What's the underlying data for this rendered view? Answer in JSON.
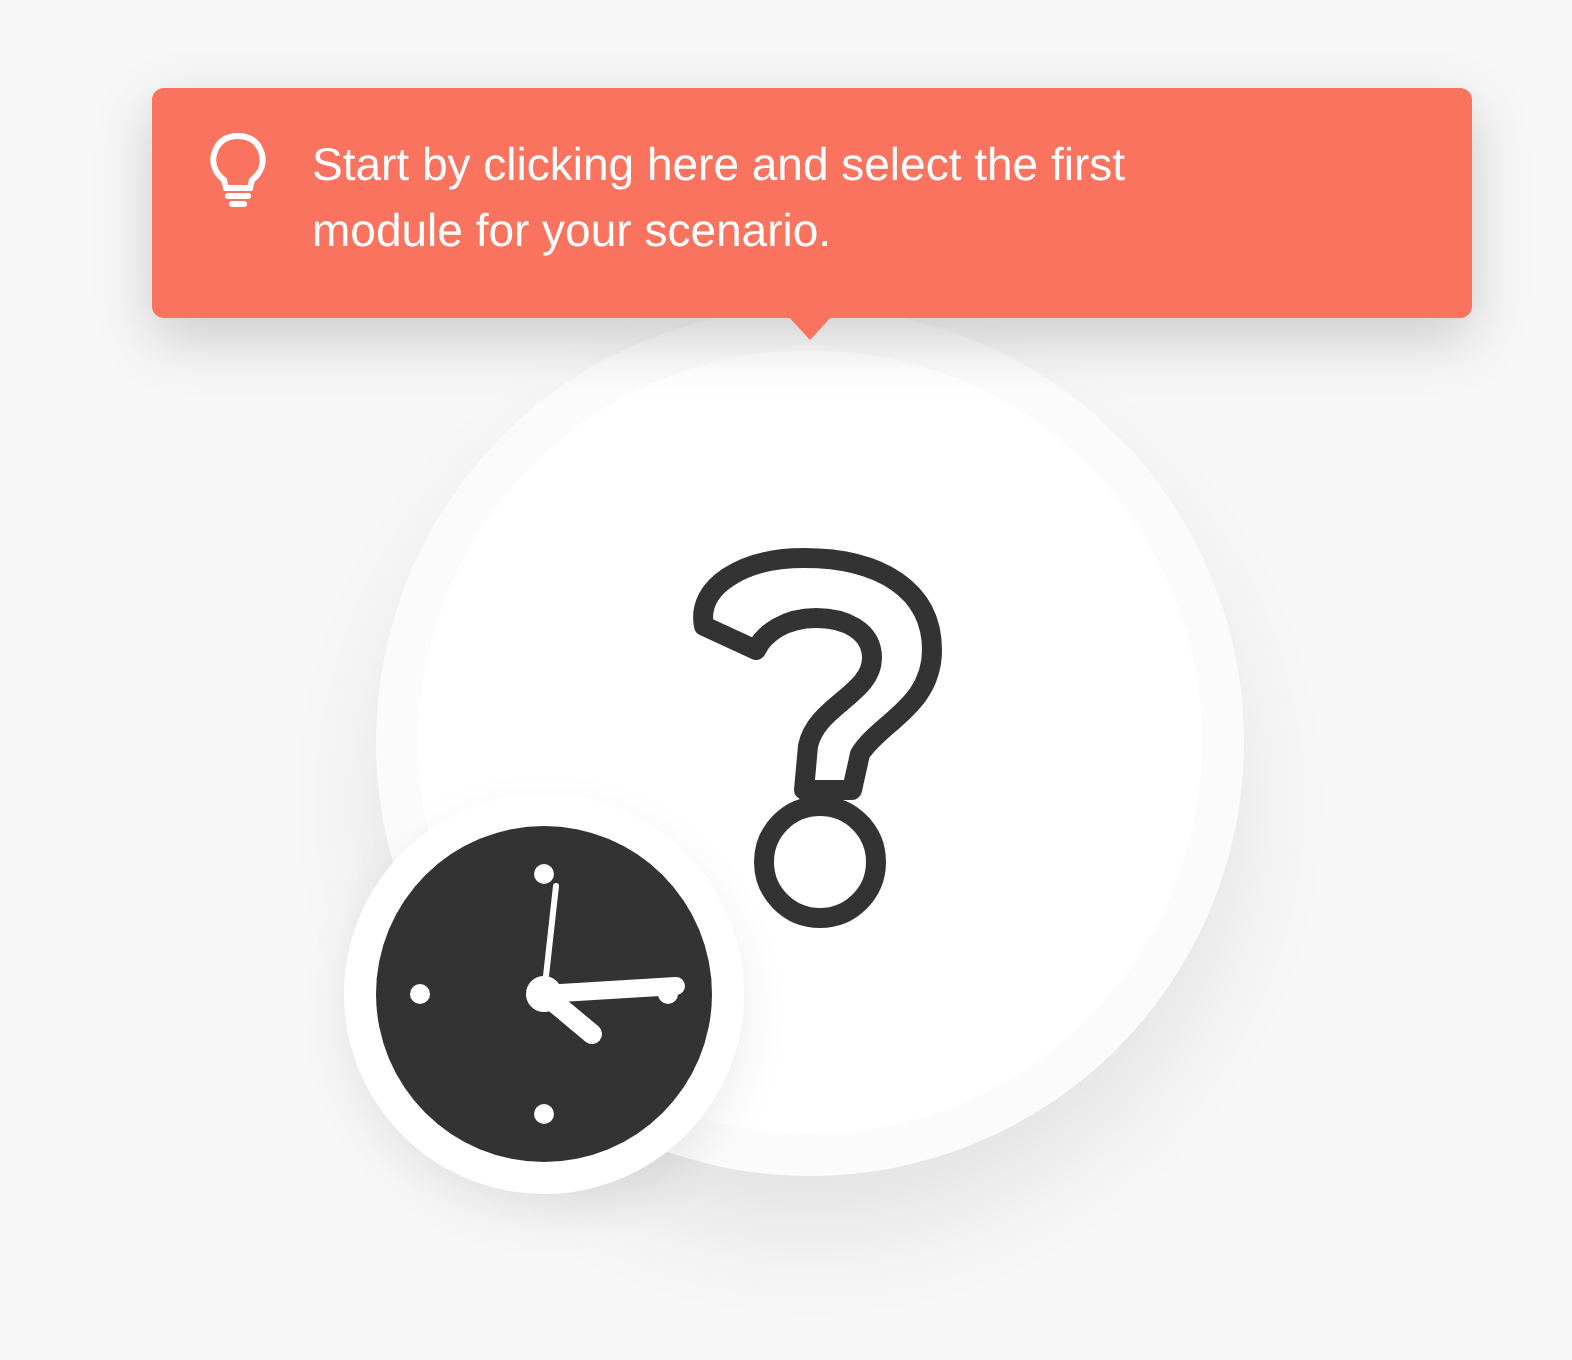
{
  "tooltip": {
    "text": "Start by clicking here and select the first module for your scenario."
  }
}
